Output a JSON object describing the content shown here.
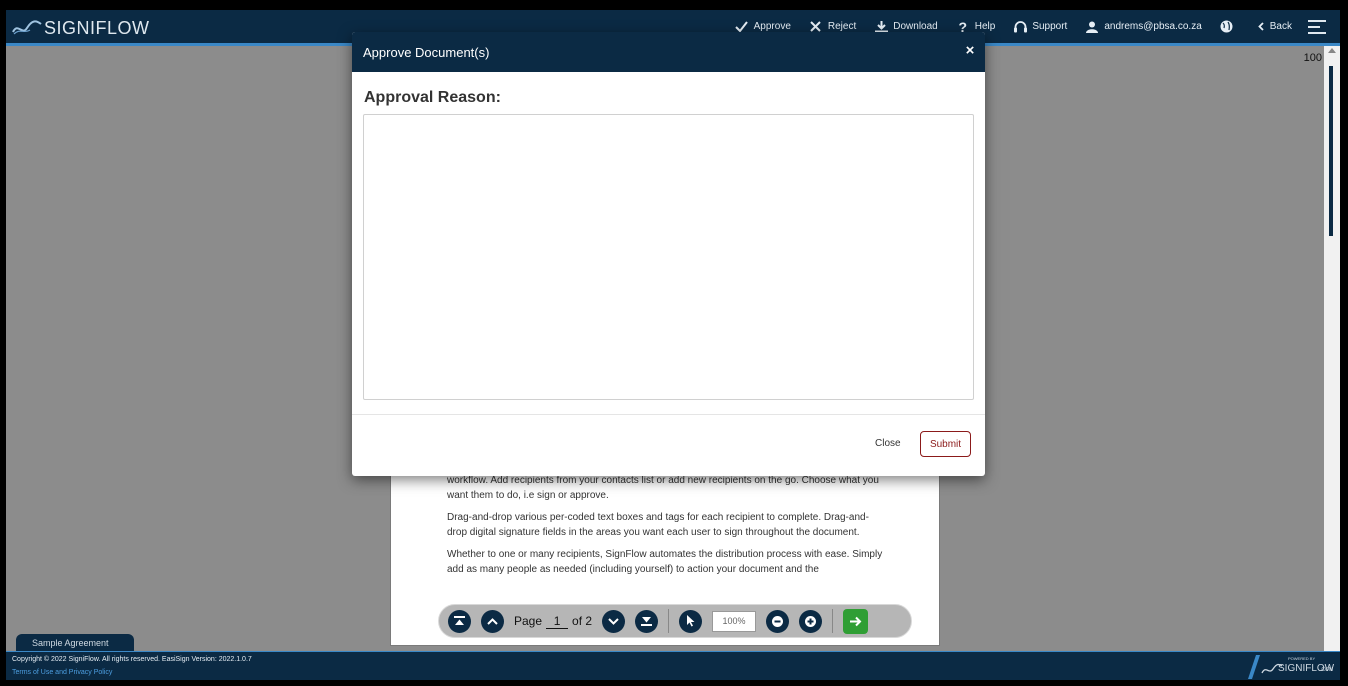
{
  "brand": {
    "name": "SIGNIFLOW"
  },
  "nav": {
    "approve": "Approve",
    "reject": "Reject",
    "download": "Download",
    "help": "Help",
    "support": "Support",
    "user": "andrems@pbsa.co.za",
    "back": "Back"
  },
  "viewer": {
    "zoom_indicator": "100",
    "paragraphs": [
      "workflow. Add recipients from your contacts list or add new recipients on the go. Choose what you want them to do, i.e sign or approve.",
      "Drag-and-drop various per-coded text boxes and tags for each recipient to complete. Drag-and-drop digital signature fields in the areas you want each user to sign throughout the document.",
      "Whether to one or many recipients, SignFlow automates the distribution process with ease. Simply add as many people as needed (including yourself) to action your document and the"
    ]
  },
  "pager": {
    "page_label": "Page",
    "current_page": "1",
    "of_label": "of 2",
    "zoom_value": "100%"
  },
  "doc_tab": {
    "label": "Sample Agreement"
  },
  "footer": {
    "copyright": "Copyright © 2022 SigniFlow. All rights reserved. EasiSign Version: 2022.1.0.7",
    "terms": "Terms of Use and Privacy Policy",
    "powered_by": "POWERED BY",
    "powered_brand": "SIGNIFLOW",
    "powered_suffix": ".COM"
  },
  "modal": {
    "title": "Approve Document(s)",
    "close_x": "×",
    "reason_label": "Approval Reason:",
    "reason_value": "",
    "close_label": "Close",
    "submit_label": "Submit"
  },
  "colors": {
    "navy": "#0b2a44",
    "accent_blue": "#3a88c7",
    "submit_red": "#8b1a1a",
    "go_green": "#2f9e34"
  }
}
